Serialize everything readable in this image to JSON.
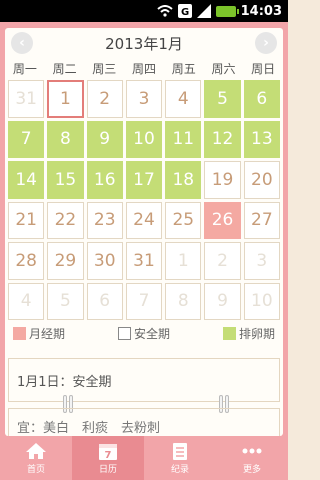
{
  "status": {
    "time": "14:03"
  },
  "calendar": {
    "title": "2013年1月",
    "prev": "‹",
    "next": "›",
    "weekdays": [
      "周一",
      "周二",
      "周三",
      "周四",
      "周五",
      "周六",
      "周日"
    ],
    "days": [
      {
        "n": "31",
        "t": "other"
      },
      {
        "n": "1",
        "t": "today"
      },
      {
        "n": "2",
        "t": "safe"
      },
      {
        "n": "3",
        "t": "safe"
      },
      {
        "n": "4",
        "t": "safe"
      },
      {
        "n": "5",
        "t": "ovul"
      },
      {
        "n": "6",
        "t": "ovul"
      },
      {
        "n": "7",
        "t": "ovul"
      },
      {
        "n": "8",
        "t": "ovul"
      },
      {
        "n": "9",
        "t": "ovul"
      },
      {
        "n": "10",
        "t": "ovul"
      },
      {
        "n": "11",
        "t": "ovul"
      },
      {
        "n": "12",
        "t": "ovul"
      },
      {
        "n": "13",
        "t": "ovul"
      },
      {
        "n": "14",
        "t": "ovul"
      },
      {
        "n": "15",
        "t": "ovul"
      },
      {
        "n": "16",
        "t": "ovul"
      },
      {
        "n": "17",
        "t": "ovul"
      },
      {
        "n": "18",
        "t": "ovul"
      },
      {
        "n": "19",
        "t": "safe"
      },
      {
        "n": "20",
        "t": "safe"
      },
      {
        "n": "21",
        "t": "safe"
      },
      {
        "n": "22",
        "t": "safe"
      },
      {
        "n": "23",
        "t": "safe"
      },
      {
        "n": "24",
        "t": "safe"
      },
      {
        "n": "25",
        "t": "safe"
      },
      {
        "n": "26",
        "t": "period"
      },
      {
        "n": "27",
        "t": "safe"
      },
      {
        "n": "28",
        "t": "safe"
      },
      {
        "n": "29",
        "t": "safe"
      },
      {
        "n": "30",
        "t": "safe"
      },
      {
        "n": "31",
        "t": "safe"
      },
      {
        "n": "1",
        "t": "other"
      },
      {
        "n": "2",
        "t": "other"
      },
      {
        "n": "3",
        "t": "other"
      },
      {
        "n": "4",
        "t": "other"
      },
      {
        "n": "5",
        "t": "other"
      },
      {
        "n": "6",
        "t": "other"
      },
      {
        "n": "7",
        "t": "other"
      },
      {
        "n": "8",
        "t": "other"
      },
      {
        "n": "9",
        "t": "other"
      },
      {
        "n": "10",
        "t": "other"
      }
    ]
  },
  "legend": {
    "period": "月经期",
    "safe": "安全期",
    "ovulation": "排卵期"
  },
  "info": {
    "selected": "1月1日：安全期"
  },
  "advice": {
    "text": "宜：美白　利痰　去粉刺"
  },
  "tabs": [
    {
      "label": "首页",
      "icon": "home-icon"
    },
    {
      "label": "日历",
      "icon": "calendar-icon",
      "day": "7"
    },
    {
      "label": "纪录",
      "icon": "notes-icon"
    },
    {
      "label": "更多",
      "icon": "more-icon"
    }
  ],
  "colors": {
    "accent": "#f2a5a9",
    "ovulation": "#c4dd76",
    "period": "#f4a9a2",
    "today_border": "#e37d79"
  }
}
